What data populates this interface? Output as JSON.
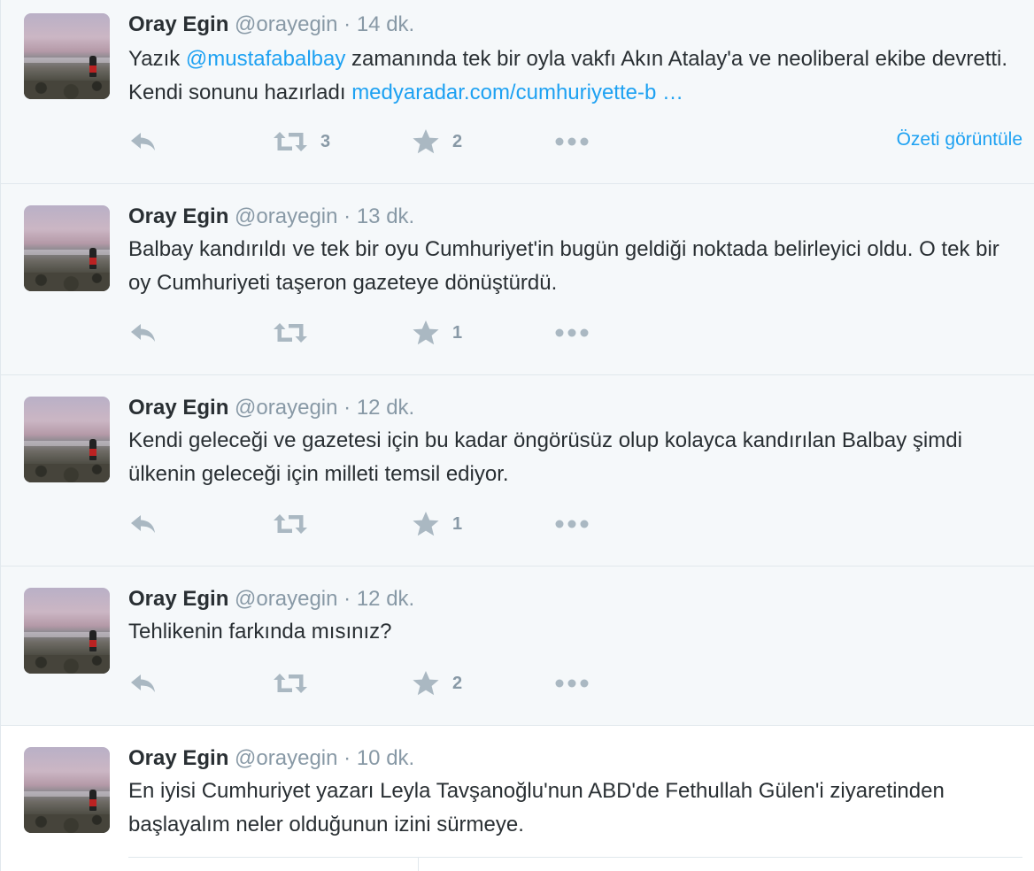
{
  "tweets": [
    {
      "name": "Oray Egin",
      "handle": "@orayegin",
      "sep": "·",
      "time": "14 dk.",
      "text_pre": "Yazık ",
      "mention": "@mustafabalbay",
      "text_mid": " zamanında tek bir oyla vakfı Akın Atalay'a ve neoliberal ekibe devretti. Kendi sonunu hazırladı ",
      "link": "medyaradar.com/cumhuriyette-b …",
      "retweets": "3",
      "favorites": "2",
      "summary": "Özeti görüntüle"
    },
    {
      "name": "Oray Egin",
      "handle": "@orayegin",
      "sep": "·",
      "time": "13 dk.",
      "text": "Balbay kandırıldı ve tek bir oyu Cumhuriyet'in bugün geldiği noktada belirleyici oldu. O tek bir oy Cumhuriyeti taşeron gazeteye dönüştürdü.",
      "retweets": "",
      "favorites": "1"
    },
    {
      "name": "Oray Egin",
      "handle": "@orayegin",
      "sep": "·",
      "time": "12 dk.",
      "text": "Kendi geleceği ve gazetesi için bu kadar öngörüsüz olup kolayca kandırılan Balbay şimdi ülkenin geleceği için milleti temsil ediyor.",
      "retweets": "",
      "favorites": "1"
    },
    {
      "name": "Oray Egin",
      "handle": "@orayegin",
      "sep": "·",
      "time": "12 dk.",
      "text": "Tehlikenin farkında mısınız?",
      "retweets": "",
      "favorites": "2"
    },
    {
      "name": "Oray Egin",
      "handle": "@orayegin",
      "sep": "·",
      "time": "10 dk.",
      "text": "En iyisi Cumhuriyet yazarı Leyla Tavşanoğlu'nun ABD'de Fethullah Gülen'i ziyaretinden başlayalım neler olduğunun izini sürmeye."
    }
  ],
  "colors": {
    "link": "#1da1f2",
    "muted": "#8899a6",
    "text": "#292f33",
    "background": "#f5f8fa",
    "border": "#e1e8ed"
  },
  "icons": [
    "reply-icon",
    "retweet-icon",
    "favorite-icon",
    "more-icon"
  ]
}
